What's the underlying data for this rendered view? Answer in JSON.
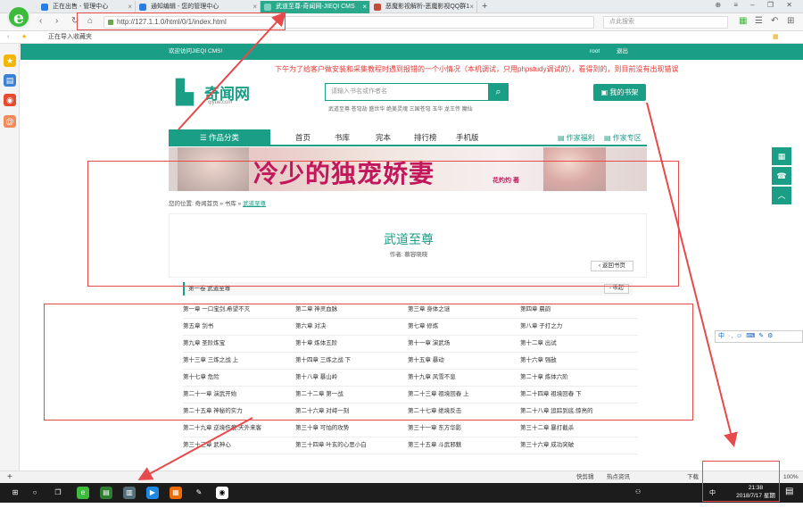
{
  "browser": {
    "tabs": [
      {
        "title": "正在出售 - 管理中心",
        "active": false,
        "color": "#2a7de1"
      },
      {
        "title": "通知编辑 - 您的管理中心",
        "active": false,
        "color": "#2a7de1"
      },
      {
        "title": "武道至尊-奇闻网-JIEQI CMS",
        "active": true,
        "color": "#ffffff"
      },
      {
        "title": "恶魔影视解析-恶魔影视QQ群1",
        "active": false,
        "color": "#c24b3a"
      }
    ],
    "new_tab": "+",
    "url": "http://127.1.1.0/html/0/1/index.html",
    "search_placeholder": "点此搜索",
    "favbar_text": "正在导入收藏夹",
    "logo_letter": "e",
    "nav": {
      "back": "‹",
      "forward": "›",
      "refresh": "↻",
      "home": "⌂"
    }
  },
  "site": {
    "welcome": "欢迎访问JIEQI CMS!",
    "user": "root",
    "logout": "退出",
    "marquee": "下午为了给客户做安装和采集教程时遇到报错的一个小情况（本机调试，只用phpstudy调试的），看得到的，到目前没有出现错误",
    "brand_name": "奇闻网",
    "brand_domain": "qiyue.com",
    "search_placeholder": "请输入书名或作者名",
    "hot_keywords": "武道至尊 苍穹劫 盛世华 绝美灵魂 三国苍穹 玉华 龙王传 魔仙",
    "my_shelf": "我的书架",
    "categories": "作品分类",
    "menu": [
      "首页",
      "书库",
      "完本",
      "排行榜",
      "手机版"
    ],
    "menu_right": [
      "作家福利",
      "作家专区"
    ],
    "banner_title": "冷少的独宠娇妻",
    "banner_author": "花灼灼 著",
    "breadcrumb_prefix": "您的位置:",
    "breadcrumb": [
      "奇闻首页",
      "书库",
      "武道至尊"
    ],
    "book_title": "武道至尊",
    "book_author": "作者: 慕容晓晓",
    "back_to_book": "返回书页",
    "volume_title": "第一卷 武道至尊",
    "collapse": "收起",
    "chapters": [
      "第一章 一口宝剑,希望不灭",
      "第二章 神灵血脉",
      "第三章 身体之谜",
      "第四章 晨韵",
      "第五章 剑书",
      "第六章 对决",
      "第七章 修炼",
      "第八章 子打之力",
      "第九章 圣阶炼宝",
      "第十章 炼体五阶",
      "第十一章 演武场",
      "第十二章 出试",
      "第十三章 三炼之战 上",
      "第十四章 三炼之战 下",
      "第十五章 暴动",
      "第十六章 强敌",
      "第十七章 危险",
      "第十八章 暴山岭",
      "第十九章 风雪不息",
      "第二十章 炼体六阶",
      "第二十一章 演武开始",
      "第二十二章 第一战",
      "第二十三章 祖境回春 上",
      "第二十四章 祖境回春 下",
      "第二十五章 神秘的实力",
      "第二十六章 对峙一刻",
      "第二十七章 绝境反击",
      "第二十八章 追踪到底,惊亮的",
      "第二十九章 逆境伤痕,天外来客",
      "第三十章 可怕的攻势",
      "第三十一章 东方华影",
      "第三十二章 暴打截杀",
      "第三十三章 武神心",
      "第三十四章 叶玄的心思小白",
      "第三十五章 斗武邪魅",
      "第三十六章 成功突破"
    ],
    "float_buttons": [
      "▦",
      "☎",
      "︿"
    ]
  },
  "ime": "中 ·, ☺ ⌨ ✎ ⚙",
  "statusbar": {
    "left": "+",
    "items": [
      "快剪辑",
      "热点资讯",
      "下载",
      "100%"
    ]
  },
  "taskbar": {
    "time": "21:38",
    "date": "2018/7/17 星期二",
    "lang": "中"
  },
  "sidebar_icons": [
    "★",
    "▤",
    "◉",
    "@"
  ]
}
